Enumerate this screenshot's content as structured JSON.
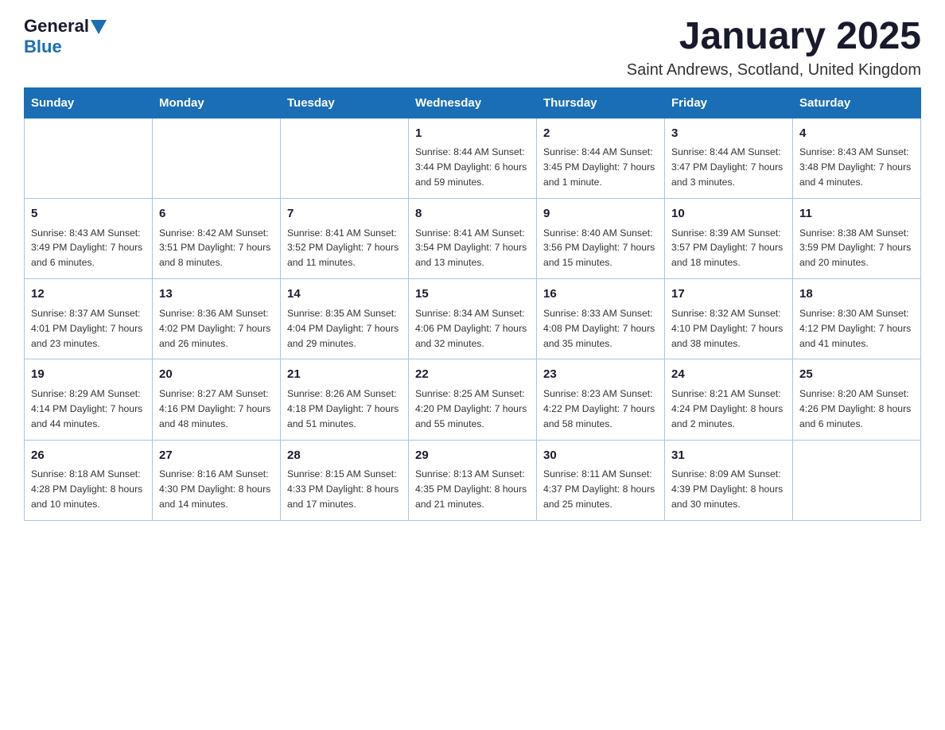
{
  "header": {
    "logo_general": "General",
    "logo_blue": "Blue",
    "title": "January 2025",
    "subtitle": "Saint Andrews, Scotland, United Kingdom"
  },
  "weekdays": [
    "Sunday",
    "Monday",
    "Tuesday",
    "Wednesday",
    "Thursday",
    "Friday",
    "Saturday"
  ],
  "weeks": [
    [
      {
        "day": "",
        "info": ""
      },
      {
        "day": "",
        "info": ""
      },
      {
        "day": "",
        "info": ""
      },
      {
        "day": "1",
        "info": "Sunrise: 8:44 AM\nSunset: 3:44 PM\nDaylight: 6 hours\nand 59 minutes."
      },
      {
        "day": "2",
        "info": "Sunrise: 8:44 AM\nSunset: 3:45 PM\nDaylight: 7 hours\nand 1 minute."
      },
      {
        "day": "3",
        "info": "Sunrise: 8:44 AM\nSunset: 3:47 PM\nDaylight: 7 hours\nand 3 minutes."
      },
      {
        "day": "4",
        "info": "Sunrise: 8:43 AM\nSunset: 3:48 PM\nDaylight: 7 hours\nand 4 minutes."
      }
    ],
    [
      {
        "day": "5",
        "info": "Sunrise: 8:43 AM\nSunset: 3:49 PM\nDaylight: 7 hours\nand 6 minutes."
      },
      {
        "day": "6",
        "info": "Sunrise: 8:42 AM\nSunset: 3:51 PM\nDaylight: 7 hours\nand 8 minutes."
      },
      {
        "day": "7",
        "info": "Sunrise: 8:41 AM\nSunset: 3:52 PM\nDaylight: 7 hours\nand 11 minutes."
      },
      {
        "day": "8",
        "info": "Sunrise: 8:41 AM\nSunset: 3:54 PM\nDaylight: 7 hours\nand 13 minutes."
      },
      {
        "day": "9",
        "info": "Sunrise: 8:40 AM\nSunset: 3:56 PM\nDaylight: 7 hours\nand 15 minutes."
      },
      {
        "day": "10",
        "info": "Sunrise: 8:39 AM\nSunset: 3:57 PM\nDaylight: 7 hours\nand 18 minutes."
      },
      {
        "day": "11",
        "info": "Sunrise: 8:38 AM\nSunset: 3:59 PM\nDaylight: 7 hours\nand 20 minutes."
      }
    ],
    [
      {
        "day": "12",
        "info": "Sunrise: 8:37 AM\nSunset: 4:01 PM\nDaylight: 7 hours\nand 23 minutes."
      },
      {
        "day": "13",
        "info": "Sunrise: 8:36 AM\nSunset: 4:02 PM\nDaylight: 7 hours\nand 26 minutes."
      },
      {
        "day": "14",
        "info": "Sunrise: 8:35 AM\nSunset: 4:04 PM\nDaylight: 7 hours\nand 29 minutes."
      },
      {
        "day": "15",
        "info": "Sunrise: 8:34 AM\nSunset: 4:06 PM\nDaylight: 7 hours\nand 32 minutes."
      },
      {
        "day": "16",
        "info": "Sunrise: 8:33 AM\nSunset: 4:08 PM\nDaylight: 7 hours\nand 35 minutes."
      },
      {
        "day": "17",
        "info": "Sunrise: 8:32 AM\nSunset: 4:10 PM\nDaylight: 7 hours\nand 38 minutes."
      },
      {
        "day": "18",
        "info": "Sunrise: 8:30 AM\nSunset: 4:12 PM\nDaylight: 7 hours\nand 41 minutes."
      }
    ],
    [
      {
        "day": "19",
        "info": "Sunrise: 8:29 AM\nSunset: 4:14 PM\nDaylight: 7 hours\nand 44 minutes."
      },
      {
        "day": "20",
        "info": "Sunrise: 8:27 AM\nSunset: 4:16 PM\nDaylight: 7 hours\nand 48 minutes."
      },
      {
        "day": "21",
        "info": "Sunrise: 8:26 AM\nSunset: 4:18 PM\nDaylight: 7 hours\nand 51 minutes."
      },
      {
        "day": "22",
        "info": "Sunrise: 8:25 AM\nSunset: 4:20 PM\nDaylight: 7 hours\nand 55 minutes."
      },
      {
        "day": "23",
        "info": "Sunrise: 8:23 AM\nSunset: 4:22 PM\nDaylight: 7 hours\nand 58 minutes."
      },
      {
        "day": "24",
        "info": "Sunrise: 8:21 AM\nSunset: 4:24 PM\nDaylight: 8 hours\nand 2 minutes."
      },
      {
        "day": "25",
        "info": "Sunrise: 8:20 AM\nSunset: 4:26 PM\nDaylight: 8 hours\nand 6 minutes."
      }
    ],
    [
      {
        "day": "26",
        "info": "Sunrise: 8:18 AM\nSunset: 4:28 PM\nDaylight: 8 hours\nand 10 minutes."
      },
      {
        "day": "27",
        "info": "Sunrise: 8:16 AM\nSunset: 4:30 PM\nDaylight: 8 hours\nand 14 minutes."
      },
      {
        "day": "28",
        "info": "Sunrise: 8:15 AM\nSunset: 4:33 PM\nDaylight: 8 hours\nand 17 minutes."
      },
      {
        "day": "29",
        "info": "Sunrise: 8:13 AM\nSunset: 4:35 PM\nDaylight: 8 hours\nand 21 minutes."
      },
      {
        "day": "30",
        "info": "Sunrise: 8:11 AM\nSunset: 4:37 PM\nDaylight: 8 hours\nand 25 minutes."
      },
      {
        "day": "31",
        "info": "Sunrise: 8:09 AM\nSunset: 4:39 PM\nDaylight: 8 hours\nand 30 minutes."
      },
      {
        "day": "",
        "info": ""
      }
    ]
  ]
}
